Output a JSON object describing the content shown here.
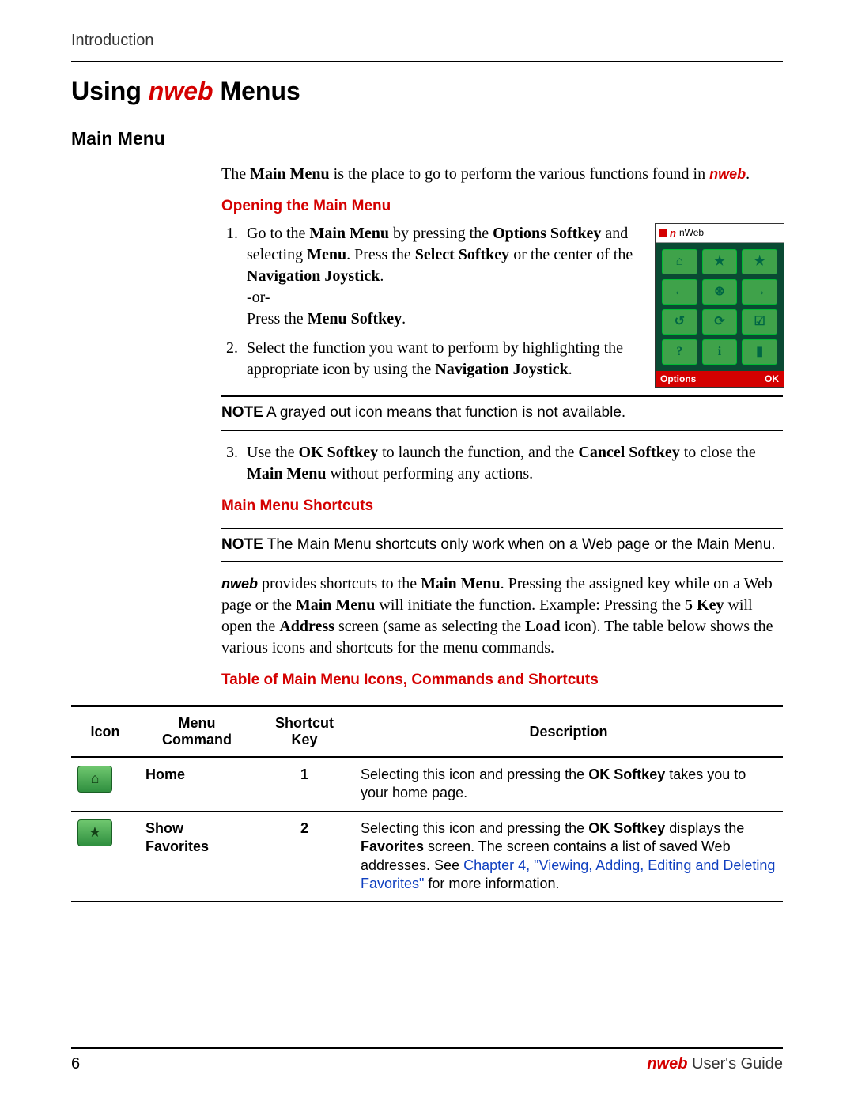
{
  "header": {
    "section": "Introduction"
  },
  "title": {
    "pre": "Using ",
    "brand": "nweb",
    "post": " Menus"
  },
  "h2": "Main Menu",
  "intro": {
    "t1": "The ",
    "b1": "Main Menu",
    "t2": " is the place to go to perform the various functions found in ",
    "brand": "nweb",
    "t3": "."
  },
  "open": {
    "heading": "Opening the Main Menu",
    "step1": {
      "a": "Go to the ",
      "b1": "Main Menu",
      "c": " by pressing the ",
      "b2": "Options Softkey",
      "d": " and selecting ",
      "b3": "Menu",
      "e": ". Press the ",
      "b4": "Select Softkey",
      "f": " or the center of the ",
      "b5": "Navigation Joystick",
      "g": ".",
      "or": "-or-",
      "h": "Press the ",
      "b6": "Menu Softkey",
      "i": "."
    },
    "step2": {
      "a": "Select the function you want to perform by highlighting the appropriate icon by using the ",
      "b1": "Navigation Joystick",
      "c": "."
    },
    "step3": {
      "a": "Use the ",
      "b1": "OK Softkey",
      "b": " to launch the function, and the ",
      "b2": "Cancel Softkey",
      "c": " to close the ",
      "b3": "Main Menu",
      "d": " without performing any actions."
    }
  },
  "phone": {
    "titleN": "n",
    "titleRest": "nWeb",
    "left": "Options",
    "right": "OK",
    "cells": [
      "⌂",
      "★",
      "★",
      "←",
      "⊛",
      "→",
      "↺",
      "⟳",
      "☑",
      "?",
      "i",
      "▮"
    ]
  },
  "note1": {
    "label": "NOTE",
    "text": "  A grayed out icon means that function is not available."
  },
  "shortcuts": {
    "heading": "Main Menu Shortcuts",
    "noteLabel": "NOTE",
    "noteText": "  The Main Menu shortcuts only work when on a Web page or the Main Menu.",
    "p": {
      "brand": "nweb",
      "a": " provides shortcuts to the ",
      "b1": "Main Menu",
      "b": ". Pressing the assigned key while on a Web page or the ",
      "b2": "Main Menu",
      "c": " will initiate the function. Example: Pressing the ",
      "b3": "5 Key",
      "d": " will open the ",
      "b4": "Address",
      "e": " screen (same as selecting the ",
      "b5": "Load",
      "f": " icon). The table below shows the various icons and shortcuts for the menu commands."
    },
    "tableHeading": "Table of Main Menu Icons, Commands and Shortcuts"
  },
  "table": {
    "head": {
      "icon": "Icon",
      "cmd": "Menu Command",
      "key": "Shortcut Key",
      "desc": "Description"
    },
    "rows": [
      {
        "iconGlyph": "⌂",
        "cmd": "Home",
        "key": "1",
        "desc": {
          "a": "Selecting this icon and pressing the ",
          "b1": "OK Softkey",
          "b": " takes you to your home page."
        }
      },
      {
        "iconGlyph": "★",
        "cmd": "Show Favorites",
        "key": "2",
        "desc": {
          "a": "Selecting this icon and pressing the ",
          "b1": "OK Softkey",
          "b": " displays the ",
          "b2": "Favorites",
          "c": " screen. The screen contains a list of saved Web addresses. See ",
          "link": "Chapter 4, \"Viewing, Adding, Editing and Deleting Favorites\"",
          "d": " for more information."
        }
      }
    ]
  },
  "footer": {
    "page": "6",
    "brand": "nweb",
    "rest": " User's Guide"
  }
}
